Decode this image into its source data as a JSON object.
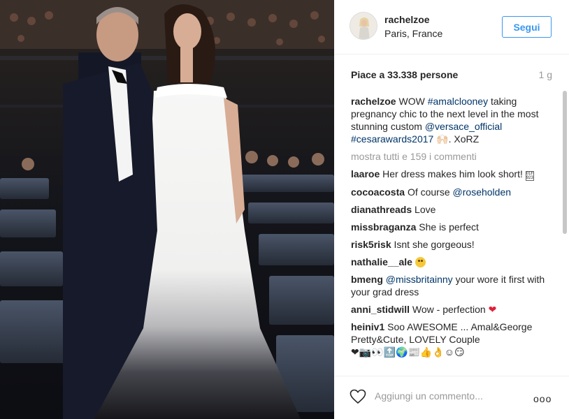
{
  "post": {
    "username": "rachelzoe",
    "location": "Paris, France",
    "follow_label": "Segui",
    "likes": "Piace a 33.338 persone",
    "time": "1 g"
  },
  "caption": {
    "user": "rachelzoe",
    "text_1": "WOW ",
    "tag_1": "#amalclooney",
    "text_2": " taking pregnancy chic to the next level in the most stunning custom ",
    "tag_2": "@versace_official",
    "text_3": " ",
    "tag_3": "#cesarawards2017",
    "emoji": "🙌🏻",
    "text_4": ". XoRZ"
  },
  "view_all": "mostra tutti e 159 i commenti",
  "comments": [
    {
      "user": "laaroe",
      "text": "Her dress makes him look short!"
    },
    {
      "user": "cocoacosta",
      "text": "Of course ",
      "tag": "@roseholden"
    },
    {
      "user": "dianathreads",
      "text": "Love"
    },
    {
      "user": "missbraganza",
      "text": "She is perfect"
    },
    {
      "user": "risk5risk",
      "text": "Isnt she gorgeous!"
    },
    {
      "user": "nathalie__ale",
      "text": ""
    },
    {
      "user": "bmeng",
      "tag": "@missbritainny",
      "text": " your wore it first with your grad dress"
    },
    {
      "user": "anni_stidwill",
      "text": "Wow - perfection "
    },
    {
      "user": "heiniv1",
      "text": "Soo AWESOME ... Amal&George Pretty&Cute, LOVELY Couple",
      "emoji_line": "❤📷👀🔝🌍📰👍👌☺😏"
    }
  ],
  "footer": {
    "comment_placeholder": "Aggiungi un commento...",
    "more_label": "ooo"
  },
  "icons": {
    "like": "heart-outline-icon",
    "options": "more-options-icon"
  },
  "colors": {
    "accent": "#3897f0",
    "link": "#003569",
    "muted": "#999999"
  }
}
